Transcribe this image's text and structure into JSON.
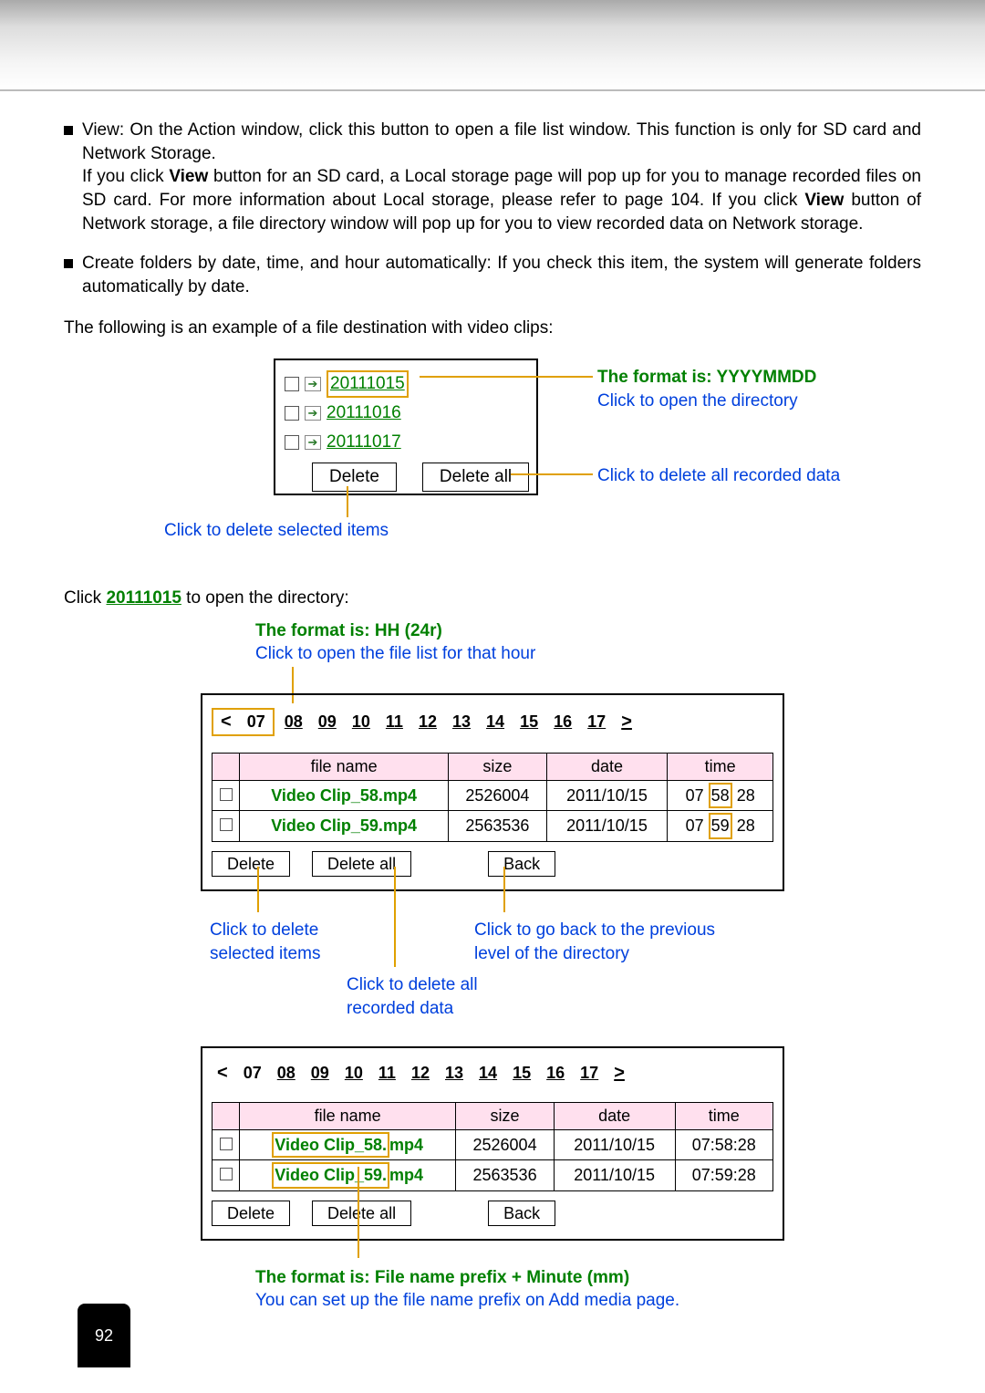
{
  "para1_lead": "View: On the Action window, click this button to open a file list window. This function is only for SD card and Network Storage.",
  "para1_rest_a": "If you click ",
  "para1_view": "View",
  "para1_rest_b": " button for an SD card, a Local storage page will pop up for you to manage recorded files on SD card. For more information about Local storage, please refer to page 104. If you click ",
  "para1_rest_c": " button of Network storage, a file directory window will pop up for you to view recorded data on Network storage.",
  "para2": "Create folders by date, time, and hour automatically: If you check this item, the system will generate folders automatically by date.",
  "para3": "The following is an example of a file destination with video clips:",
  "folders": [
    "20111015",
    "20111016",
    "20111017"
  ],
  "btn_delete": "Delete",
  "btn_deleteall": "Delete all",
  "btn_back": "Back",
  "anno_format_date": "The format is: YYYYMMDD",
  "anno_click_open_dir": "Click to open the directory",
  "anno_click_del_all": "Click to delete all recorded data",
  "anno_click_del_sel": "Click to delete selected items",
  "para4_a": "Click ",
  "para4_link": "20111015",
  "para4_b": " to open the directory:",
  "anno_format_hh": "The format is: HH (24r)",
  "anno_click_open_hour": "Click to open the file list for that hour",
  "hours": [
    "07",
    "08",
    "09",
    "10",
    "11",
    "12",
    "13",
    "14",
    "15",
    "16",
    "17"
  ],
  "arrow_l": "<",
  "arrow_r": ">",
  "th_fname": "file name",
  "th_size": "size",
  "th_date": "date",
  "th_time": "time",
  "rows": [
    {
      "name_pre": "Video Clip_58.",
      "name_ext": "mp4",
      "size": "2526004",
      "date": "2011/10/15",
      "t1": "07",
      "t2": "58",
      "t3": "28",
      "time": "07:58:28"
    },
    {
      "name_pre": "Video Clip_59.",
      "name_ext": "mp4",
      "size": "2563536",
      "date": "2011/10/15",
      "t1": "07",
      "t2": "59",
      "t3": "28",
      "time": "07:59:28"
    }
  ],
  "anno_click_del_sel2": "Click to delete\nselected items",
  "anno_click_del_all2": "Click to delete all\nrecorded data",
  "anno_click_back": "Click to go back to the previous\nlevel of the directory",
  "anno_format_fname": "The format is: File name prefix + Minute (mm)",
  "anno_fname_setup": "You can set up the file name prefix on Add media page.",
  "page_number": "92"
}
